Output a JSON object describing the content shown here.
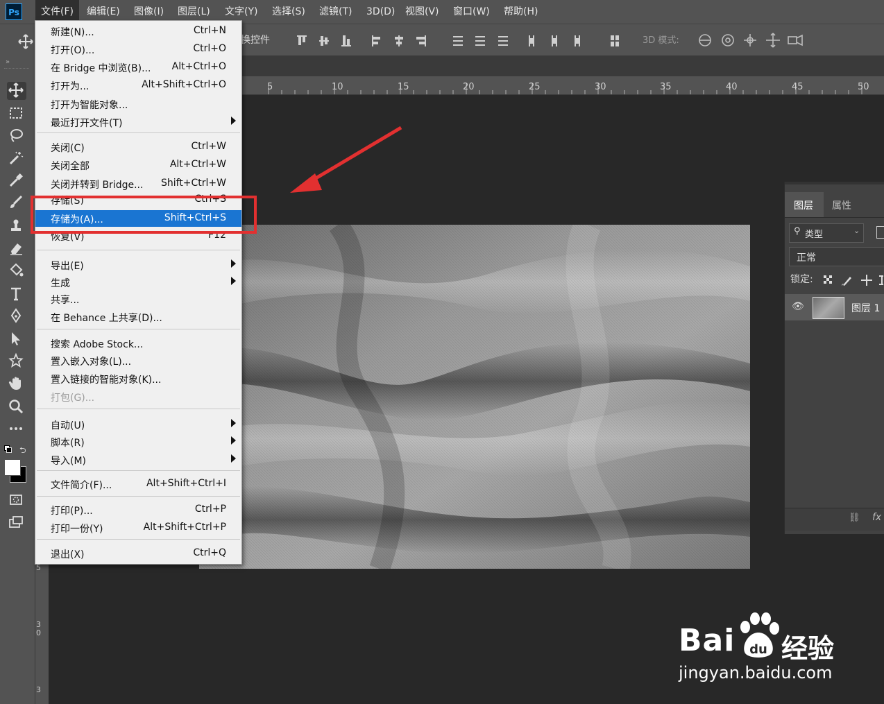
{
  "app_logo": "Ps",
  "menubar": [
    "文件(F)",
    "编辑(E)",
    "图像(I)",
    "图层(L)",
    "文字(Y)",
    "选择(S)",
    "滤镜(T)",
    "3D(D)",
    "视图(V)",
    "窗口(W)",
    "帮助(H)"
  ],
  "options_bar": {
    "transform_controls": "换控件",
    "mode_3d": "3D 模式:"
  },
  "ruler_top": [
    "5",
    "10",
    "15",
    "20",
    "25",
    "30",
    "35",
    "40",
    "45",
    "50"
  ],
  "ruler_left": [
    "5",
    "3",
    "0",
    "3"
  ],
  "file_menu": {
    "items": [
      {
        "label": "新建(N)...",
        "shortcut": "Ctrl+N"
      },
      {
        "label": "打开(O)...",
        "shortcut": "Ctrl+O"
      },
      {
        "label": "在 Bridge 中浏览(B)...",
        "shortcut": "Alt+Ctrl+O"
      },
      {
        "label": "打开为...",
        "shortcut": "Alt+Shift+Ctrl+O"
      },
      {
        "label": "打开为智能对象...",
        "shortcut": ""
      },
      {
        "label": "最近打开文件(T)",
        "shortcut": "",
        "submenu": true
      },
      {
        "label": "关闭(C)",
        "shortcut": "Ctrl+W"
      },
      {
        "label": "关闭全部",
        "shortcut": "Alt+Ctrl+W"
      },
      {
        "label": "关闭并转到 Bridge...",
        "shortcut": "Shift+Ctrl+W"
      },
      {
        "label": "存储(S)",
        "shortcut": "Ctrl+S"
      },
      {
        "label": "存储为(A)...",
        "shortcut": "Shift+Ctrl+S",
        "highlighted": true
      },
      {
        "label": "恢复(V)",
        "shortcut": "F12"
      },
      {
        "label": "导出(E)",
        "shortcut": "",
        "submenu": true
      },
      {
        "label": "生成",
        "shortcut": "",
        "submenu": true
      },
      {
        "label": "共享...",
        "shortcut": ""
      },
      {
        "label": "在 Behance 上共享(D)...",
        "shortcut": ""
      },
      {
        "label": "搜索 Adobe Stock...",
        "shortcut": ""
      },
      {
        "label": "置入嵌入对象(L)...",
        "shortcut": ""
      },
      {
        "label": "置入链接的智能对象(K)...",
        "shortcut": ""
      },
      {
        "label": "打包(G)...",
        "shortcut": "",
        "disabled": true
      },
      {
        "label": "自动(U)",
        "shortcut": "",
        "submenu": true
      },
      {
        "label": "脚本(R)",
        "shortcut": "",
        "submenu": true
      },
      {
        "label": "导入(M)",
        "shortcut": "",
        "submenu": true
      },
      {
        "label": "文件简介(F)...",
        "shortcut": "Alt+Shift+Ctrl+I"
      },
      {
        "label": "打印(P)...",
        "shortcut": "Ctrl+P"
      },
      {
        "label": "打印一份(Y)",
        "shortcut": "Alt+Shift+Ctrl+P"
      },
      {
        "label": "退出(X)",
        "shortcut": "Ctrl+Q"
      }
    ]
  },
  "layers_panel": {
    "tabs": [
      "图层",
      "属性"
    ],
    "filter_label": "类型",
    "blend_mode": "正常",
    "lock_label": "锁定:",
    "layer_name": "图层 1",
    "fx": "fx"
  },
  "watermark": {
    "brand": "Bai",
    "brand_suffix": "经验",
    "url": "jingyan.baidu.com"
  },
  "colors": {
    "highlight": "#1a75d2",
    "annotation": "#e23030",
    "ui_panel": "#535353",
    "workspace": "#282828"
  }
}
